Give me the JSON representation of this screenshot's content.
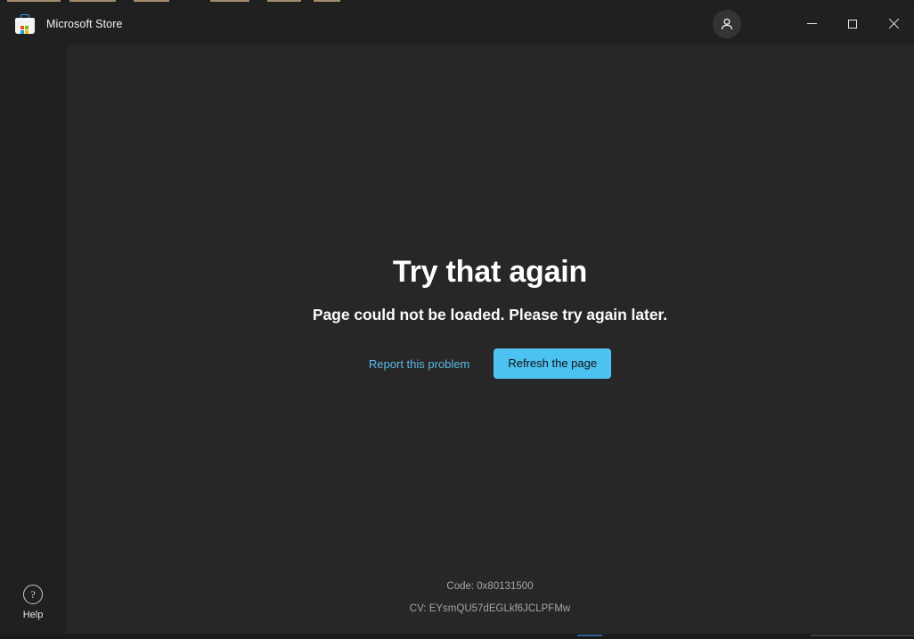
{
  "window": {
    "app_title": "Microsoft Store",
    "app_icon": "microsoft-store-icon",
    "controls": {
      "account_icon": "account-person-icon",
      "minimize_label": "Minimize",
      "maximize_label": "Maximize",
      "close_label": "Close"
    }
  },
  "sidebar": {
    "help": {
      "icon": "question-mark-circle-icon",
      "glyph": "?",
      "label": "Help"
    }
  },
  "content": {
    "error": {
      "heading": "Try that again",
      "subheading": "Page could not be loaded. Please try again later.",
      "report_link_label": "Report this problem",
      "refresh_button_label": "Refresh the page"
    },
    "diagnostics": {
      "code_label": "Code: 0x80131500",
      "cv_label": "CV: EYsmQU57dEGLkf6JCLPFMw"
    }
  },
  "colors": {
    "titlebar_background": "#202020",
    "sidebar_background": "#202020",
    "content_background": "#272727",
    "accent": "#4cc2f1",
    "link": "#5cb8e8",
    "primary_text": "#ffffff",
    "muted_text": "#a6a6a6",
    "close_hover": "#c42b1c"
  }
}
